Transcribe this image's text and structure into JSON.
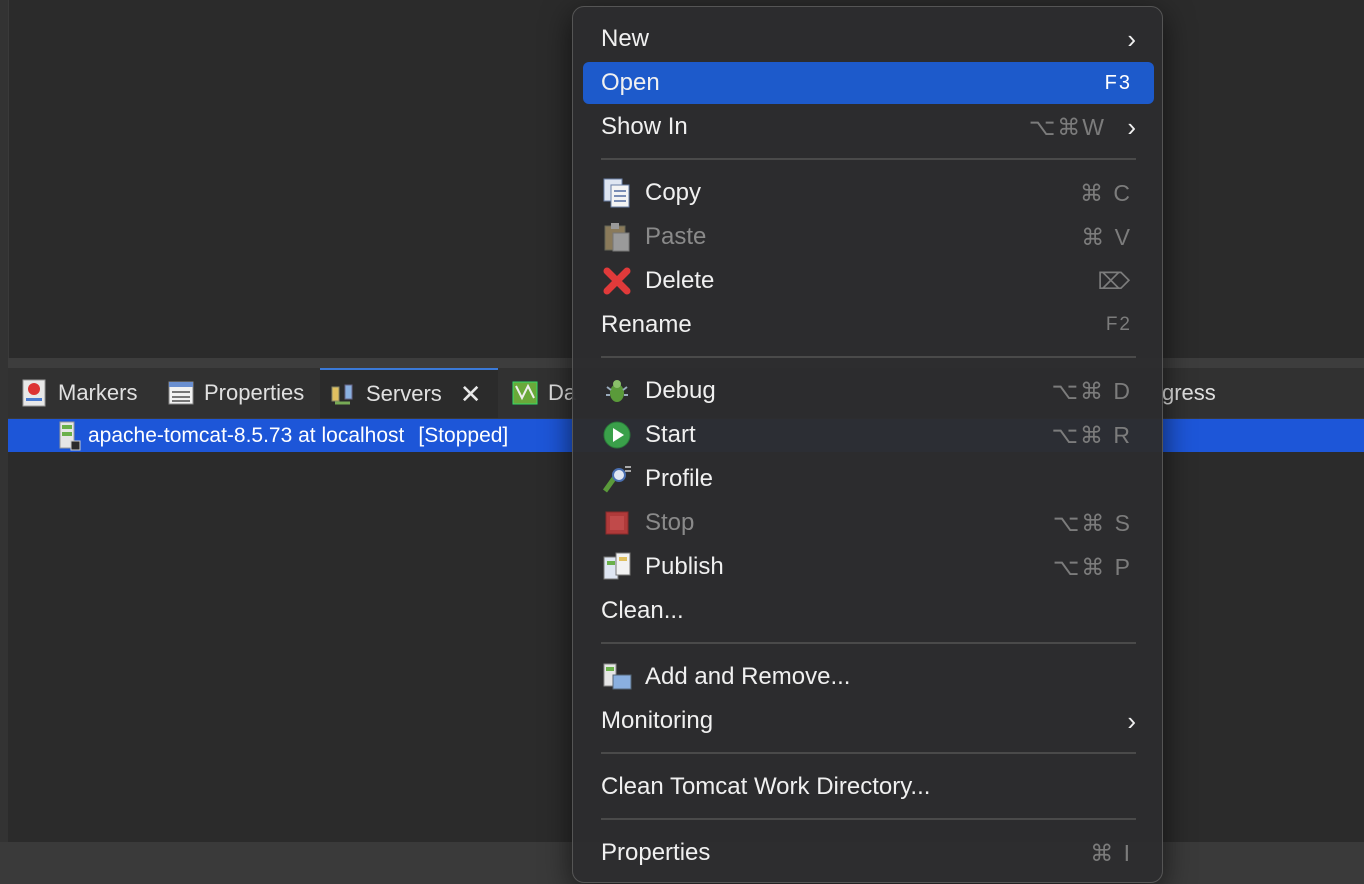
{
  "tabs": [
    {
      "label": "Markers",
      "icon": "markers-icon"
    },
    {
      "label": "Properties",
      "icon": "properties-icon"
    },
    {
      "label": "Servers",
      "icon": "servers-icon",
      "active": true
    },
    {
      "label": "Da",
      "icon": "data-source-icon"
    },
    {
      "label": "gress",
      "icon": ""
    }
  ],
  "server_row": {
    "name": "apache-tomcat-8.5.73 at localhost",
    "state": "[Stopped]"
  },
  "menu": {
    "new": {
      "label": "New"
    },
    "open": {
      "label": "Open",
      "shortcut": "F3"
    },
    "show_in": {
      "label": "Show In",
      "shortcut": "⌥⌘W"
    },
    "copy": {
      "label": "Copy",
      "shortcut": "⌘ C"
    },
    "paste": {
      "label": "Paste",
      "shortcut": "⌘ V"
    },
    "delete": {
      "label": "Delete",
      "shortcut": "⌦"
    },
    "rename": {
      "label": "Rename",
      "shortcut": "F2"
    },
    "debug": {
      "label": "Debug",
      "shortcut": "⌥⌘ D"
    },
    "start": {
      "label": "Start",
      "shortcut": "⌥⌘ R"
    },
    "profile": {
      "label": "Profile"
    },
    "stop": {
      "label": "Stop",
      "shortcut": "⌥⌘ S"
    },
    "publish": {
      "label": "Publish",
      "shortcut": "⌥⌘ P"
    },
    "clean": {
      "label": "Clean..."
    },
    "add_remove": {
      "label": "Add and Remove..."
    },
    "monitoring": {
      "label": "Monitoring"
    },
    "clean_tomcat": {
      "label": "Clean Tomcat Work Directory..."
    },
    "properties": {
      "label": "Properties",
      "shortcut": "⌘ I"
    }
  },
  "colors": {
    "highlight": "#1d5acb",
    "selection": "#1d56d8",
    "background": "#2b2b2b"
  }
}
